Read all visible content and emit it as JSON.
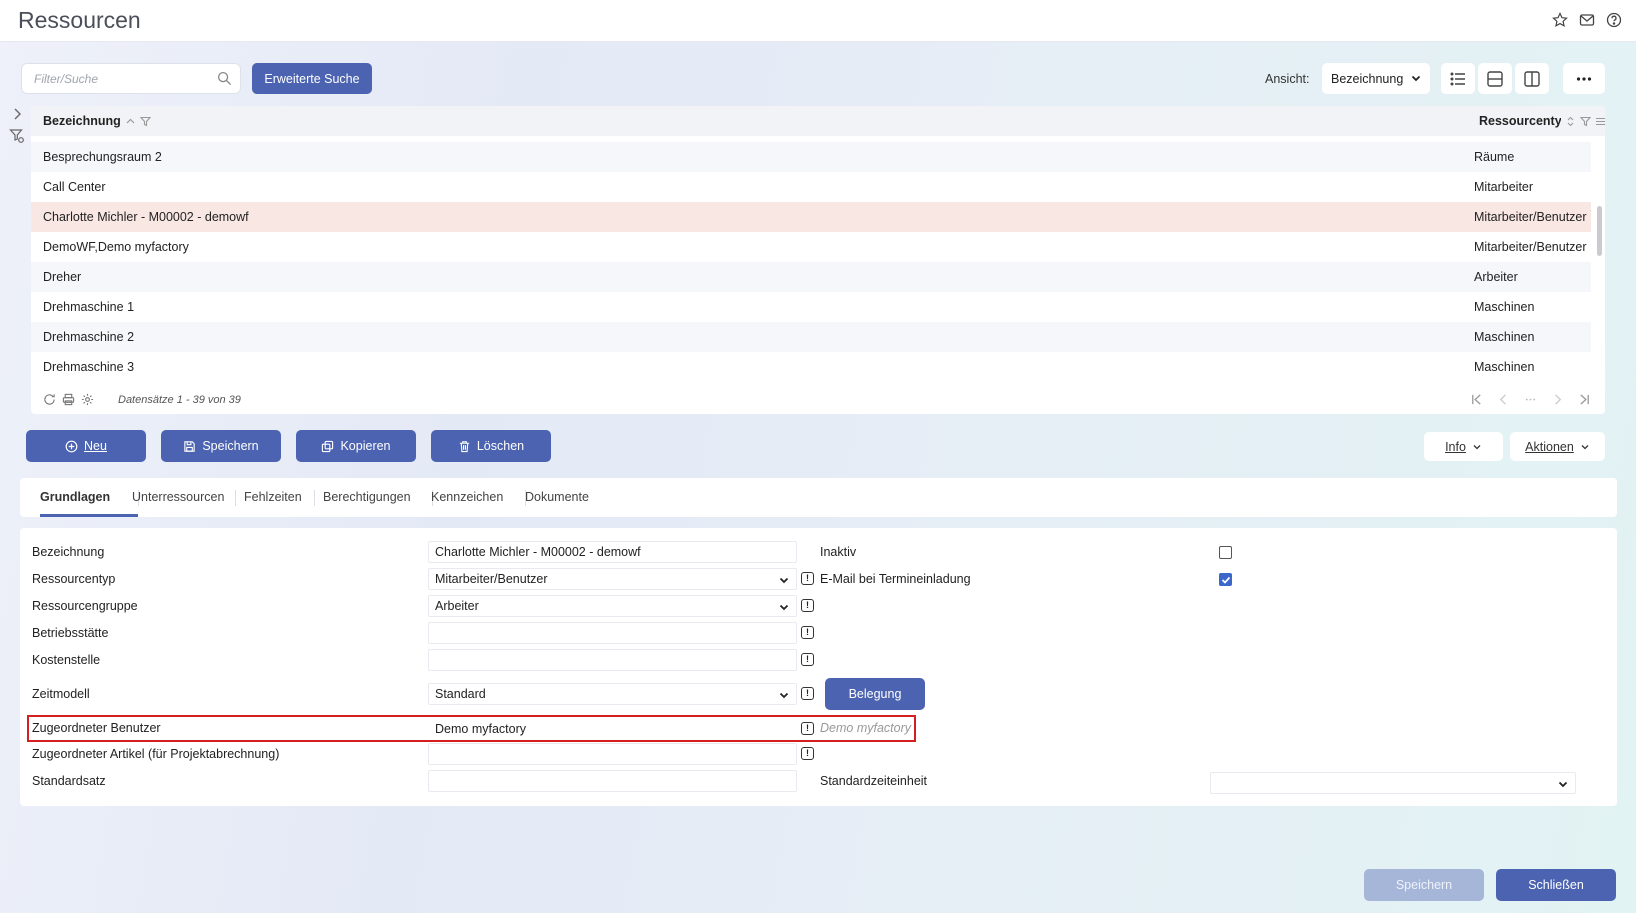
{
  "app": {
    "title": "Ressourcen"
  },
  "titlebar_icons": [
    "star-icon",
    "mail-icon",
    "help-icon"
  ],
  "toolbar": {
    "search_placeholder": "Filter/Suche",
    "search_value": "",
    "advanced_search_label": "Erweiterte Suche",
    "view_label": "Ansicht:",
    "view_selected": "Bezeichnung"
  },
  "grid": {
    "columns": [
      "Bezeichnung",
      "Ressourcentyp"
    ],
    "rows": [
      {
        "name": "Besprechungsraum 2",
        "type": "Räume"
      },
      {
        "name": "Call Center",
        "type": "Mitarbeiter"
      },
      {
        "name": "Charlotte Michler - M00002 - demowf",
        "type": "Mitarbeiter/Benutzer",
        "selected": true
      },
      {
        "name": "DemoWF,Demo myfactory",
        "type": "Mitarbeiter/Benutzer"
      },
      {
        "name": "Dreher",
        "type": "Arbeiter"
      },
      {
        "name": "Drehmaschine 1",
        "type": "Maschinen"
      },
      {
        "name": "Drehmaschine 2",
        "type": "Maschinen"
      },
      {
        "name": "Drehmaschine 3",
        "type": "Maschinen"
      }
    ],
    "footer_count": "Datensätze 1 - 39 von 39"
  },
  "actions": {
    "new_label": "Neu",
    "save_label": "Speichern",
    "copy_label": "Kopieren",
    "delete_label": "Löschen",
    "info_label": "Info",
    "actions_label": "Aktionen"
  },
  "tabs": [
    "Grundlagen",
    "Unterressourcen",
    "Fehlzeiten",
    "Berechtigungen",
    "Kennzeichen",
    "Dokumente"
  ],
  "form": {
    "bezeichnung": {
      "label": "Bezeichnung",
      "value": "Charlotte Michler - M00002 - demowf"
    },
    "ressourcentyp": {
      "label": "Ressourcentyp",
      "value": "Mitarbeiter/Benutzer"
    },
    "ressourcengruppe": {
      "label": "Ressourcengruppe",
      "value": "Arbeiter"
    },
    "betriebsstaette": {
      "label": "Betriebsstätte",
      "value": ""
    },
    "kostenstelle": {
      "label": "Kostenstelle",
      "value": ""
    },
    "zeitmodell": {
      "label": "Zeitmodell",
      "value": "Standard"
    },
    "belegung_label": "Belegung",
    "zugeordneter_benutzer": {
      "label": "Zugeordneter Benutzer",
      "value": "Demo myfactory",
      "hint": "Demo myfactory"
    },
    "zugeordneter_artikel": {
      "label": "Zugeordneter Artikel (für Projektabrechnung)",
      "value": ""
    },
    "standardsatz": {
      "label": "Standardsatz",
      "value": ""
    },
    "inaktiv": {
      "label": "Inaktiv",
      "checked": false
    },
    "email_termineinladung": {
      "label": "E-Mail bei Termineinladung",
      "checked": true
    },
    "standardzeiteinheit": {
      "label": "Standardzeiteinheit",
      "value": ""
    }
  },
  "bottom": {
    "save_label": "Speichern",
    "close_label": "Schließen"
  },
  "colors": {
    "primary": "#4b63b0",
    "selected_row": "#f9e7e4",
    "highlight_border": "#d31f1f"
  }
}
